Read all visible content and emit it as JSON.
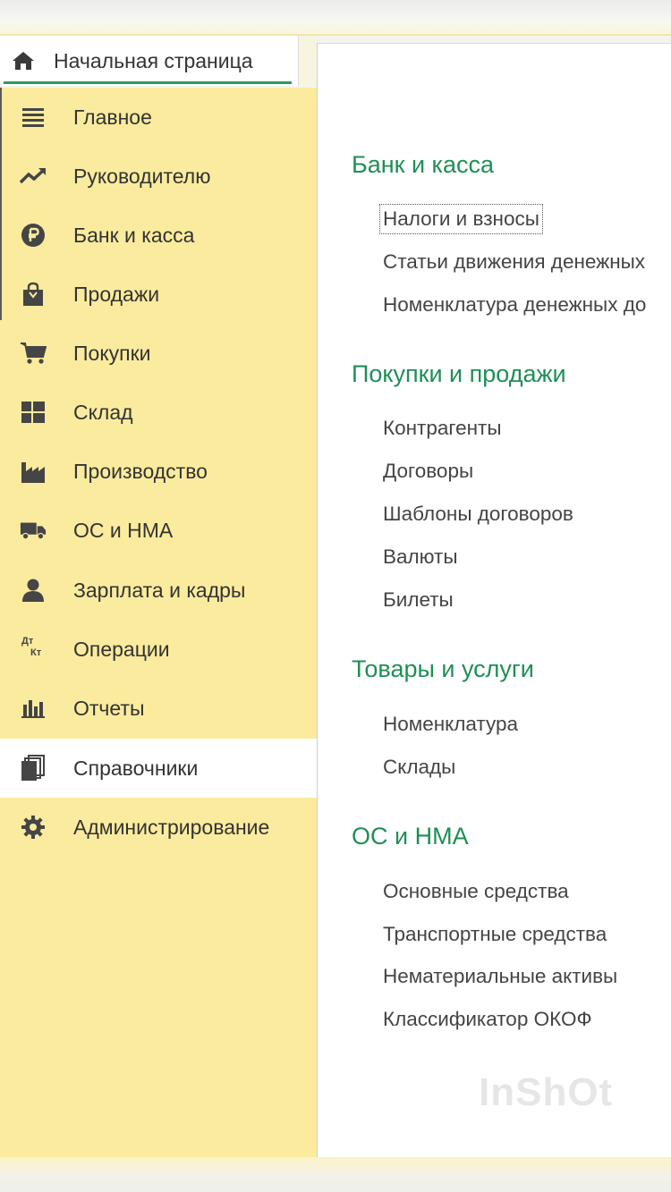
{
  "home_tab": {
    "label": "Начальная страница",
    "icon": "home-icon"
  },
  "sidebar": {
    "items": [
      {
        "label": "Главное",
        "icon": "menu-lines-icon",
        "active": false
      },
      {
        "label": "Руководителю",
        "icon": "trend-chart-icon",
        "active": false
      },
      {
        "label": "Банк и касса",
        "icon": "ruble-coin-icon",
        "active": false
      },
      {
        "label": "Продажи",
        "icon": "shopping-bag-icon",
        "active": false
      },
      {
        "label": "Покупки",
        "icon": "cart-icon",
        "active": false
      },
      {
        "label": "Склад",
        "icon": "warehouse-grid-icon",
        "active": false
      },
      {
        "label": "Производство",
        "icon": "factory-icon",
        "active": false
      },
      {
        "label": "ОС и НМА",
        "icon": "truck-icon",
        "active": false
      },
      {
        "label": "Зарплата и кадры",
        "icon": "person-icon",
        "active": false
      },
      {
        "label": "Операции",
        "icon": "debit-credit-icon",
        "active": false,
        "icon_text_top": "Дт",
        "icon_text_bottom": "Кт"
      },
      {
        "label": "Отчеты",
        "icon": "bar-chart-icon",
        "active": false
      },
      {
        "label": "Справочники",
        "icon": "books-icon",
        "active": true
      },
      {
        "label": "Администрирование",
        "icon": "gear-icon",
        "active": false
      }
    ]
  },
  "content": {
    "sections": [
      {
        "title": "Банк и касса",
        "links": [
          "Налоги и взносы",
          "Статьи движения денежных",
          "Номенклатура денежных до"
        ]
      },
      {
        "title": "Покупки и продажи",
        "links": [
          "Контрагенты",
          "Договоры",
          "Шаблоны договоров",
          "Валюты",
          "Билеты"
        ]
      },
      {
        "title": "Товары и услуги",
        "links": [
          "Номенклатура",
          "Склады"
        ]
      },
      {
        "title": "ОС и НМА",
        "links": [
          "Основные средства",
          "Транспортные средства",
          "Нематериальные активы",
          "Классификатор ОКОФ"
        ]
      }
    ]
  },
  "watermark": "InShOt",
  "colors": {
    "sidebar_bg": "#fbeb9e",
    "section_title": "#1f8f55",
    "active_underline": "#2e9a5b",
    "icon": "#4a4a4a"
  }
}
